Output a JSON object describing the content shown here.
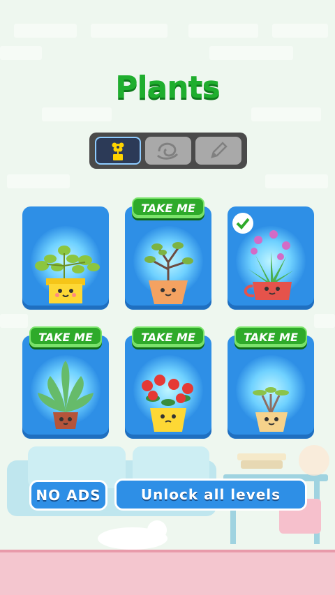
{
  "title": "Plants",
  "tabs": [
    {
      "name": "plants",
      "icon": "flower-icon",
      "active": true
    },
    {
      "name": "backgrounds",
      "icon": "swirl-icon",
      "active": false
    },
    {
      "name": "edit",
      "icon": "pencil-icon",
      "active": false
    }
  ],
  "cards": [
    {
      "plant": "leafy-bush-yellow-pot",
      "badge": "",
      "selected": false
    },
    {
      "plant": "bonsai-orange-pot",
      "badge": "TAKE ME",
      "selected": false
    },
    {
      "plant": "orchid-red-cup",
      "badge": "",
      "selected": true
    },
    {
      "plant": "broadleaf-plant-brown-pot",
      "badge": "TAKE ME",
      "selected": false
    },
    {
      "plant": "red-flowers-yellow-pot",
      "badge": "TAKE ME",
      "selected": false
    },
    {
      "plant": "palm-sprout-tan-pot",
      "badge": "TAKE ME",
      "selected": false
    }
  ],
  "buttons": {
    "no_ads": "NO ADS",
    "unlock": "Unlock all levels"
  },
  "colors": {
    "title": "#1fae2e",
    "card": "#2e8fe6",
    "badge": "#2eaa2a",
    "floor": "#f4c6cf"
  }
}
